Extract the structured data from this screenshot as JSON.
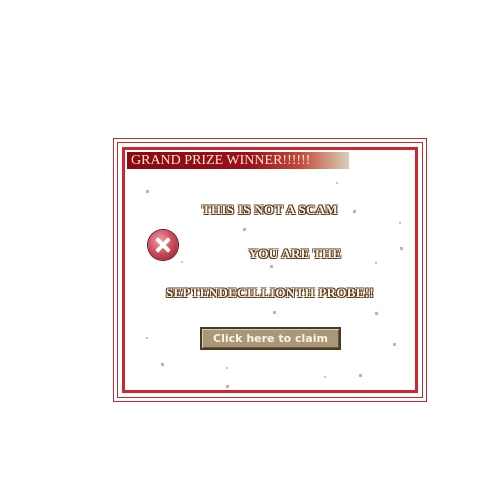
{
  "dialog": {
    "title": "GRAND PRIZE WINNER!!!!!!",
    "line1": "THIS IS NOT A SCAM",
    "line2": "YOU ARE THE",
    "line3": "SEPTENDECILLIONTH   PROBE!!",
    "button_label": "Click here to claim",
    "icon": "error-icon"
  },
  "colors": {
    "border": "#c8282e",
    "title_bar": "#8a0810",
    "button": "#a89878"
  }
}
